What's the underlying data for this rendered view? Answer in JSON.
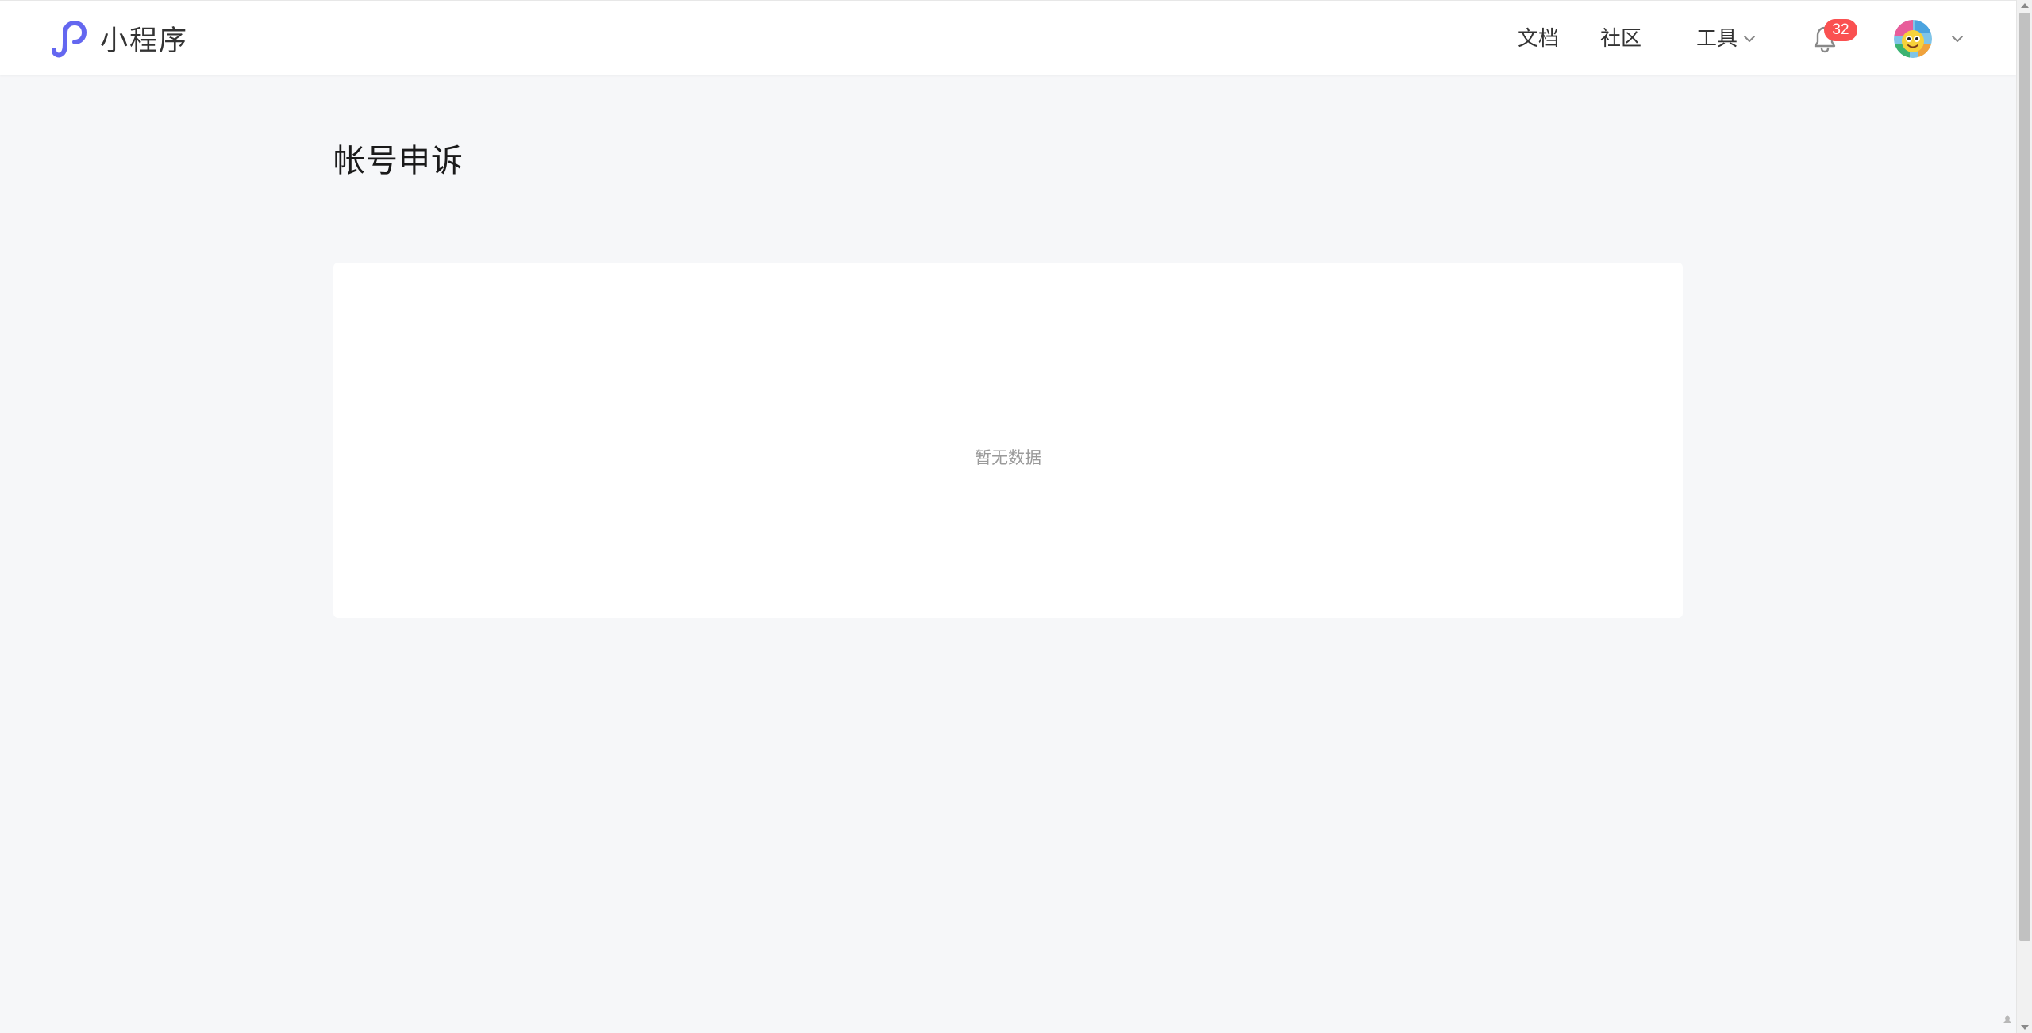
{
  "header": {
    "brand_name": "小程序",
    "nav": {
      "docs": "文档",
      "community": "社区",
      "tools": "工具"
    },
    "notifications": {
      "count": "32"
    },
    "user": {
      "avatar_alt": "avatar"
    }
  },
  "main": {
    "title": "帐号申诉",
    "empty_text": "暂无数据"
  },
  "icons": {
    "logo": "miniprogram-logo-icon",
    "tools_chevron": "chevron-down-icon",
    "bell": "bell-icon",
    "user_chevron": "chevron-down-icon"
  },
  "colors": {
    "brand": "#6467f0",
    "badge": "#fa5151",
    "page_bg": "#f6f7f9",
    "card_bg": "#ffffff"
  }
}
